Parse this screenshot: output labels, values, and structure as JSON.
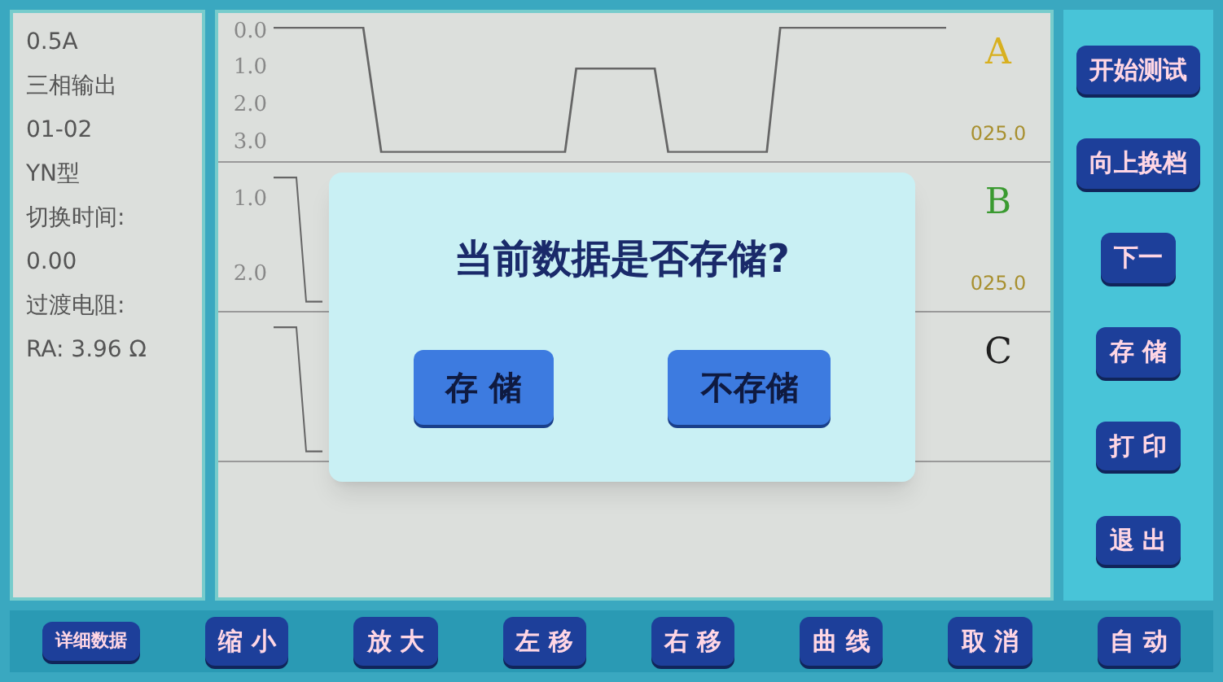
{
  "info": {
    "lines": [
      "0.5A",
      "三相输出",
      "01-02",
      "YN型",
      "切换时间:",
      "0.00",
      "过渡电阻:",
      "RA: 3.96 Ω"
    ]
  },
  "phases": [
    {
      "label": "A",
      "color": "#d8b020",
      "ticks": [
        "0.0",
        "1.0",
        "2.0",
        "3.0"
      ],
      "reading": "025.0"
    },
    {
      "label": "B",
      "color": "#3a9a30",
      "ticks": [
        "1.0",
        "2.0"
      ],
      "reading": "025.0"
    },
    {
      "label": "C",
      "color": "#202020"
    }
  ],
  "dialog": {
    "message": "当前数据是否存储?",
    "buttons": [
      "存 储",
      "不存储"
    ]
  },
  "side_buttons": [
    "开始测试",
    "向上换档",
    "下一",
    "存 储",
    "打 印",
    "退 出"
  ],
  "bottom_buttons": [
    "详细数据",
    "缩 小",
    "放 大",
    "左 移",
    "右 移",
    "曲 线",
    "取 消",
    "自 动"
  ]
}
